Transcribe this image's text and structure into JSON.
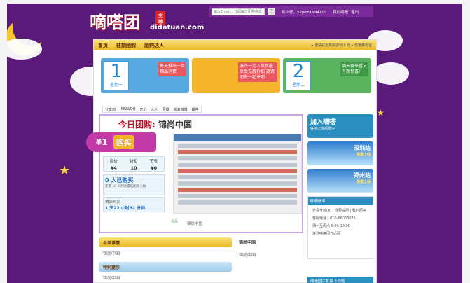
{
  "header": {
    "logo_cn": "嘀嗒团",
    "logo_badge": "全球",
    "logo_en": "didatuan.com",
    "search_placeholder": "输入Email，订阅每日团购信息",
    "go_label": "订",
    "greeting": "晚上好，52jscn198410!",
    "my_account": "我的嘀嗒",
    "logout": "退出"
  },
  "nav": {
    "items": [
      "首页",
      "往期团购",
      "团购达人"
    ],
    "right": "▸ 邀请好友购买返利 0 元  ▸ 优惠券验证"
  },
  "banner": {
    "panels": [
      {
        "num": "1",
        "label": "星期一",
        "text": "每天推出一单精品消费",
        "bg": "#58a8e0"
      },
      {
        "num": "",
        "label": "",
        "text": "凑齐一定人数就能享受无敌折扣 邀请朋友一起来吧",
        "bg": "#f5b52c"
      },
      {
        "num": "2",
        "label": "星期二",
        "text": "明天再来看又有新惊喜!",
        "bg": "#5ab35e"
      }
    ]
  },
  "share": {
    "label": "分享到:",
    "targets": [
      "MSN/QQ",
      "开心",
      "人人",
      "豆瓣",
      "新浪微博",
      "邮件"
    ]
  },
  "deal": {
    "title_prefix": "今日团购:",
    "title_name": "锦尚中国",
    "price": "¥1",
    "buy_label": "购买",
    "stats": [
      {
        "label": "原价",
        "value": "¥4"
      },
      {
        "label": "折扣",
        "value": "10"
      },
      {
        "label": "节省",
        "value": "¥0"
      }
    ],
    "buyers": "0 人已购买",
    "buyers_note": "还需 10 人到达最低团购人数",
    "timer_label": "剩余时间",
    "timer_value": "1 天22 小时32 分钟",
    "quote_text": "锦尚中国"
  },
  "sidebar": {
    "join_title": "加入嘀嗒",
    "join_sub": "各地火热招聘中",
    "city1": "深圳站",
    "city1_sub": "隆重上线",
    "city2": "郑州站",
    "city2_sub": "隆重上线",
    "weibo_title": "嘀嗒微博",
    "weibo_links": "查看全部(0) | 我要提问 | 我的问答",
    "contact": "客服电话：010-66063075",
    "hours": "周一至周六 9:00-18:00",
    "follow": "关注嘀嗒团开心网",
    "app_bar": "嘀嗒团手机版上线啦"
  },
  "lower": {
    "detail_title": "本单详情",
    "detail_text": "锦尚中国",
    "tips_title": "特别提示",
    "tips_text": "锦尚中国",
    "right_title": "锦尚中国",
    "right_text": "锦尚中国"
  }
}
